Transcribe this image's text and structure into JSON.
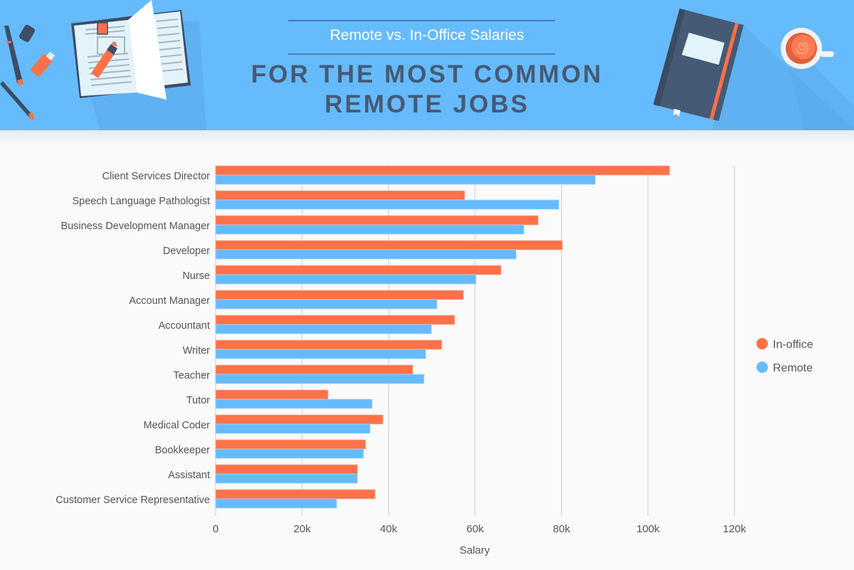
{
  "header": {
    "subtitle": "Remote vs. In-Office Salaries",
    "title_line1": "FOR THE MOST COMMON",
    "title_line2": "REMOTE JOBS",
    "decorations": [
      "pen-icon",
      "pen-cap-icon",
      "usb-drive-icon",
      "pencil-icon",
      "open-book-icon",
      "highlighter-icon",
      "notebook-icon",
      "coffee-cup-icon"
    ]
  },
  "colors": {
    "header_bg": "#66bbfc",
    "in_office": "#ff7149",
    "remote": "#66bbfc",
    "title": "#465a75",
    "text": "#555555",
    "grid": "#e3e3e3"
  },
  "chart_data": {
    "type": "bar",
    "orientation": "horizontal",
    "title": "Remote vs. In-Office Salaries For the Most Common Remote Jobs",
    "xlabel": "Salary",
    "ylabel": "",
    "xlim": [
      0,
      120000
    ],
    "xticks": [
      0,
      20000,
      40000,
      60000,
      80000,
      100000,
      120000
    ],
    "xtick_labels": [
      "0",
      "20k",
      "40k",
      "60k",
      "80k",
      "100k",
      "120k"
    ],
    "grid": true,
    "legend_position": "right",
    "categories": [
      "Client Services Director",
      "Speech Language Pathologist",
      "Business Development Manager",
      "Developer",
      "Nurse",
      "Account Manager",
      "Accountant",
      "Writer",
      "Teacher",
      "Tutor",
      "Medical Coder",
      "Bookkeeper",
      "Assistant",
      "Customer Service Representative"
    ],
    "series": [
      {
        "name": "In-office",
        "color": "#ff7149",
        "values": [
          105000,
          57600,
          74600,
          80200,
          66000,
          57300,
          55300,
          52300,
          45600,
          26000,
          38700,
          34700,
          32800,
          36900
        ]
      },
      {
        "name": "Remote",
        "color": "#66bbfc",
        "values": [
          87800,
          79400,
          71300,
          69500,
          60200,
          51200,
          49900,
          48600,
          48200,
          36200,
          35700,
          34200,
          32800,
          28000
        ]
      }
    ]
  }
}
